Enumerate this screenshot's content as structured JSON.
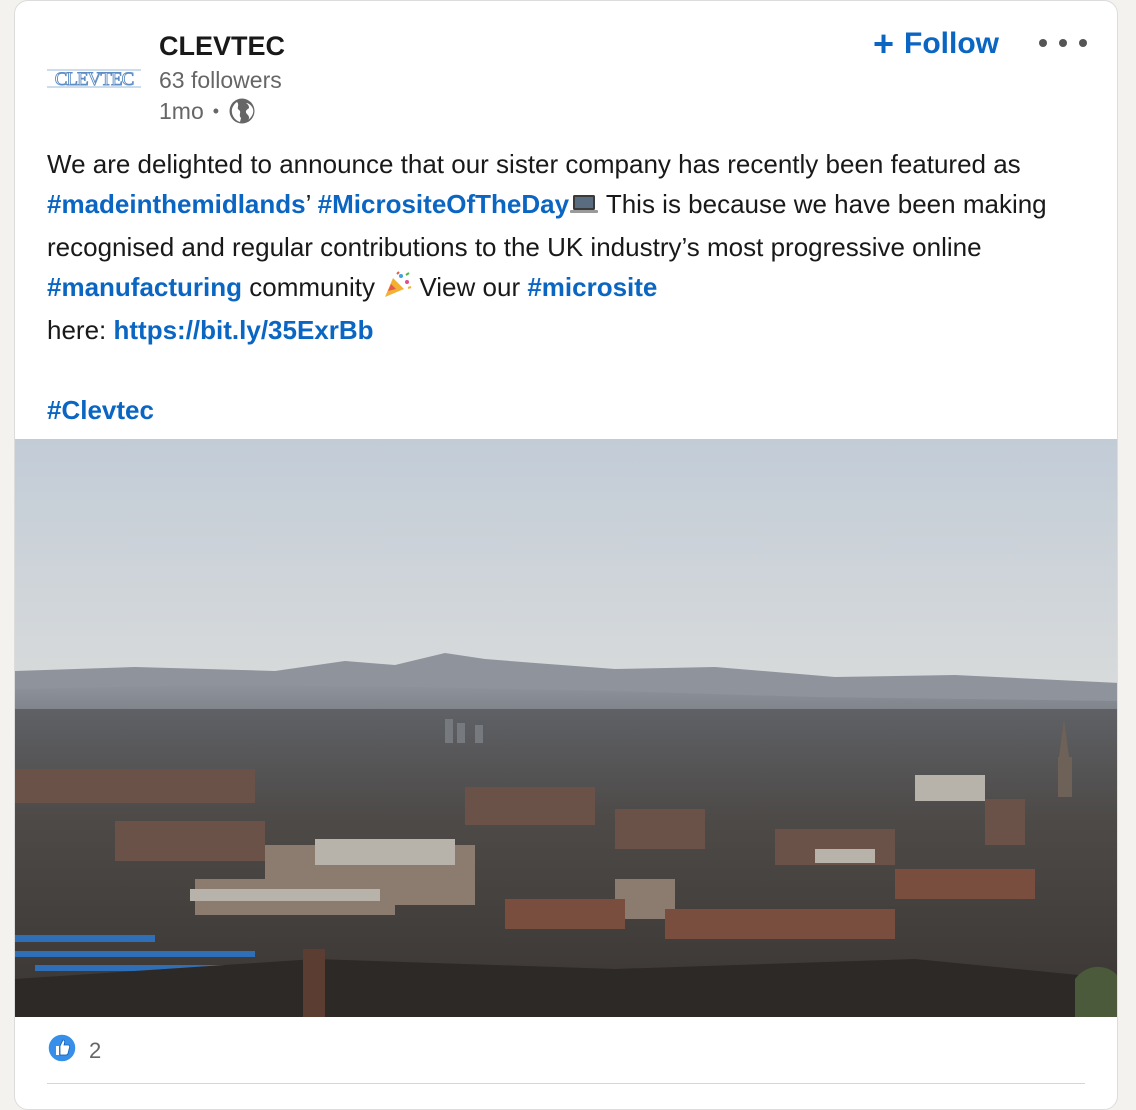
{
  "post": {
    "actor": {
      "name": "CLEVTEC",
      "followers": "63 followers",
      "time": "1mo",
      "separator": "•",
      "logo_text": "CLEVTEC",
      "visibility_icon": "globe-icon"
    },
    "follow_button": {
      "plus": "+",
      "label": "Follow"
    },
    "menu_icon": "ellipsis-icon",
    "commentary": {
      "t1": "We are delighted to announce that our sister company has recently been featured as ",
      "tag_madeinthemidlands": "#madeinthemidlands",
      "t2": "’ ",
      "tag_micrositeoftheday": "#MicrositeOfTheDay",
      "emoji_laptop": "💻",
      "t3": " This is because we have been making recognised and regular contributions to the UK industry’s most progressive online ",
      "tag_manufacturing": "#manufacturing",
      "t4": " community ",
      "emoji_party": "🎉",
      "t5": " View our ",
      "tag_microsite": "#microsite",
      "t6": " here: ",
      "link": "https://bit.ly/35ExrBb",
      "tag_clevtec": "#Clevtec"
    },
    "image": {
      "subject": "aerial town skyline at dawn"
    },
    "social_counts": {
      "reaction_icon": "like-icon",
      "reactions": "2"
    }
  },
  "colors": {
    "link_blue": "#0a66c2",
    "text_primary": "#191919",
    "text_secondary": "#666666",
    "card_bg": "#ffffff",
    "page_bg": "#f4f2ee"
  }
}
